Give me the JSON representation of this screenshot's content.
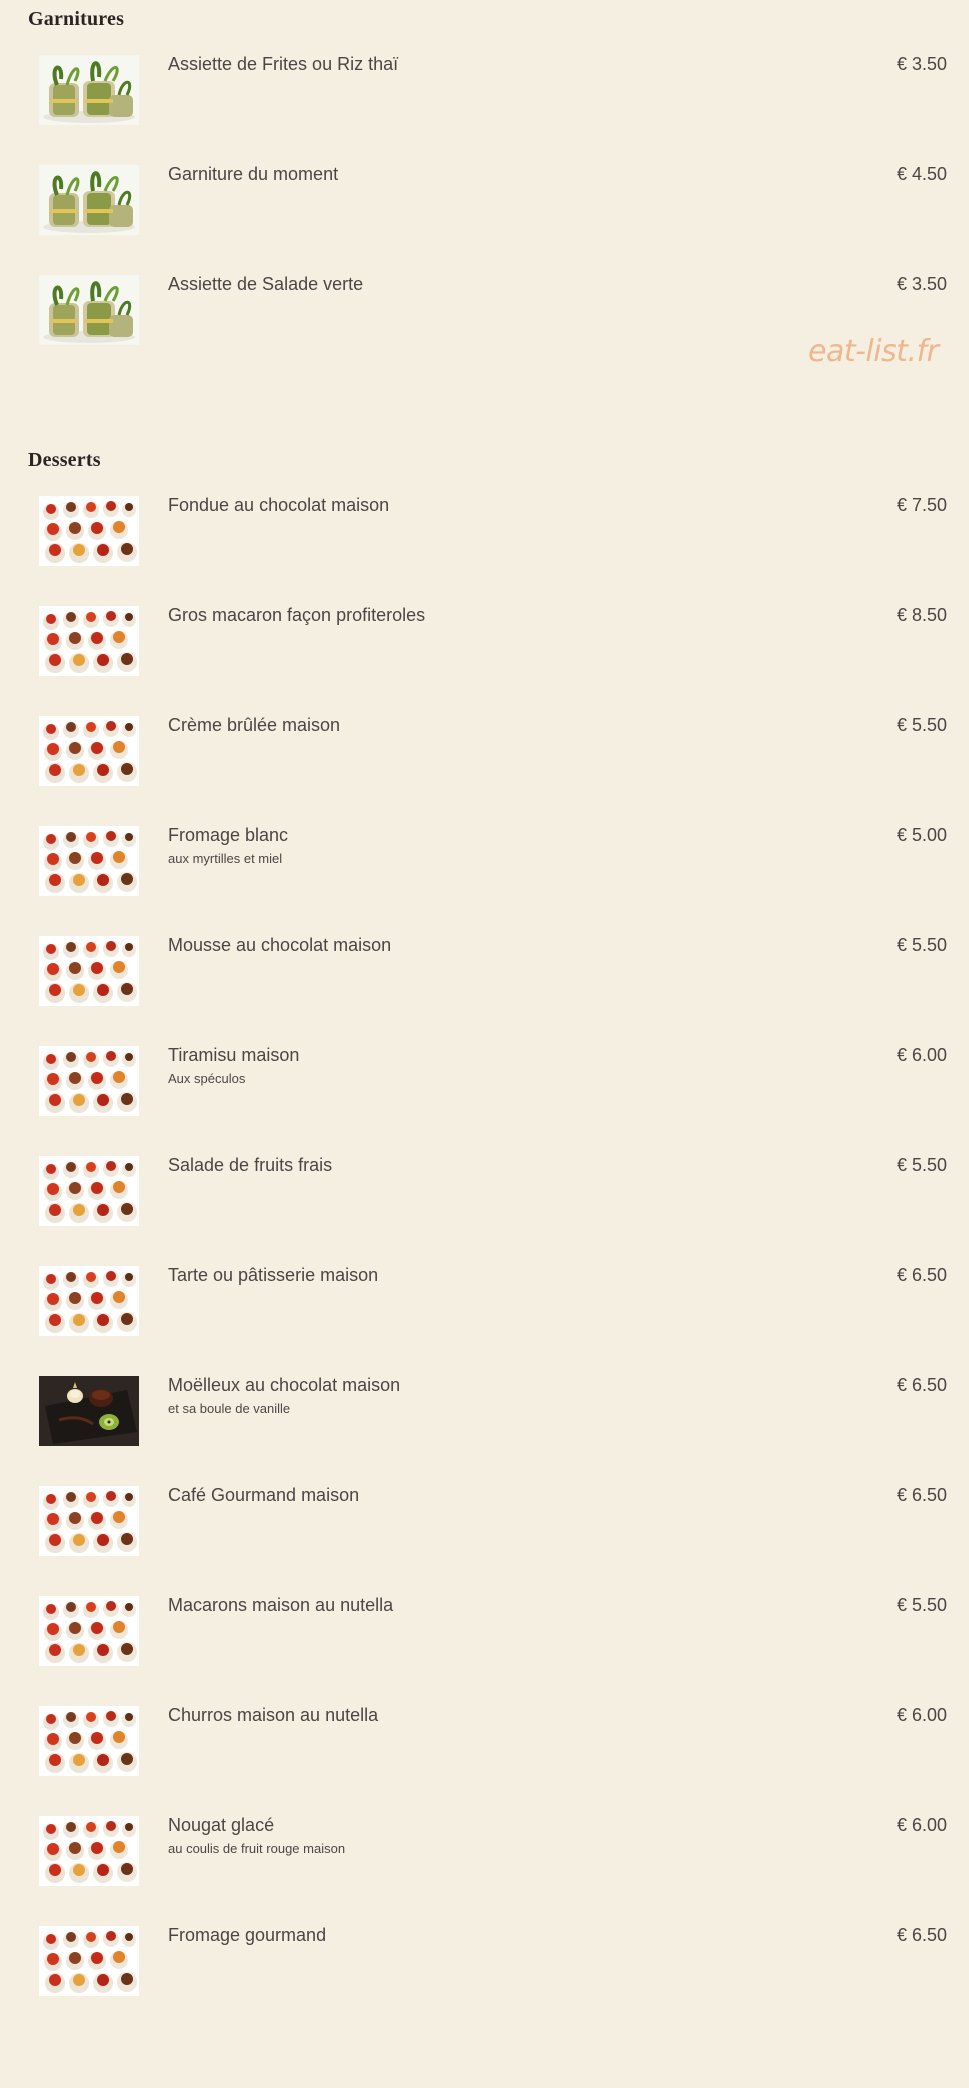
{
  "sections": [
    {
      "title": "Garnitures",
      "items": [
        {
          "name": "Assiette de Frites ou Riz thaï",
          "description": "",
          "price": "€ 3.50",
          "image": "garnish-rolls"
        },
        {
          "name": "Garniture du moment",
          "description": "",
          "price": "€ 4.50",
          "image": "garnish-rolls"
        },
        {
          "name": "Assiette de Salade verte",
          "description": "",
          "price": "€ 3.50",
          "image": "garnish-rolls"
        }
      ]
    },
    {
      "title": "Desserts",
      "items": [
        {
          "name": "Fondue au chocolat maison",
          "description": "",
          "price": "€ 7.50",
          "image": "dessert-assortment"
        },
        {
          "name": "Gros macaron façon profiteroles",
          "description": "",
          "price": "€ 8.50",
          "image": "dessert-assortment"
        },
        {
          "name": "Crème brûlée maison",
          "description": "",
          "price": "€ 5.50",
          "image": "dessert-assortment"
        },
        {
          "name": "Fromage blanc",
          "description": "aux myrtilles et miel",
          "price": "€ 5.00",
          "image": "dessert-assortment"
        },
        {
          "name": "Mousse au chocolat maison",
          "description": "",
          "price": "€ 5.50",
          "image": "dessert-assortment"
        },
        {
          "name": "Tiramisu maison",
          "description": "Aux spéculos",
          "price": "€ 6.00",
          "image": "dessert-assortment"
        },
        {
          "name": "Salade de fruits frais",
          "description": "",
          "price": "€ 5.50",
          "image": "dessert-assortment"
        },
        {
          "name": "Tarte ou pâtisserie maison",
          "description": "",
          "price": "€ 6.50",
          "image": "dessert-assortment"
        },
        {
          "name": "Moëlleux au chocolat maison",
          "description": "et sa boule de vanille",
          "price": "€ 6.50",
          "image": "chocolate-cake-plate"
        },
        {
          "name": "Café Gourmand maison",
          "description": "",
          "price": "€ 6.50",
          "image": "dessert-assortment"
        },
        {
          "name": "Macarons maison au nutella",
          "description": "",
          "price": "€ 5.50",
          "image": "dessert-assortment"
        },
        {
          "name": "Churros maison au nutella",
          "description": "",
          "price": "€ 6.00",
          "image": "dessert-assortment"
        },
        {
          "name": "Nougat glacé",
          "description": "au coulis de fruit rouge maison",
          "price": "€ 6.00",
          "image": "dessert-assortment"
        },
        {
          "name": "Fromage gourmand",
          "description": "",
          "price": "€ 6.50",
          "image": "dessert-assortment"
        }
      ]
    }
  ],
  "watermark": "eat-list.fr",
  "colors": {
    "background": "#f5efe2",
    "text": "#4b4644",
    "heading": "#2c2424",
    "watermark": "#f0b68e"
  }
}
